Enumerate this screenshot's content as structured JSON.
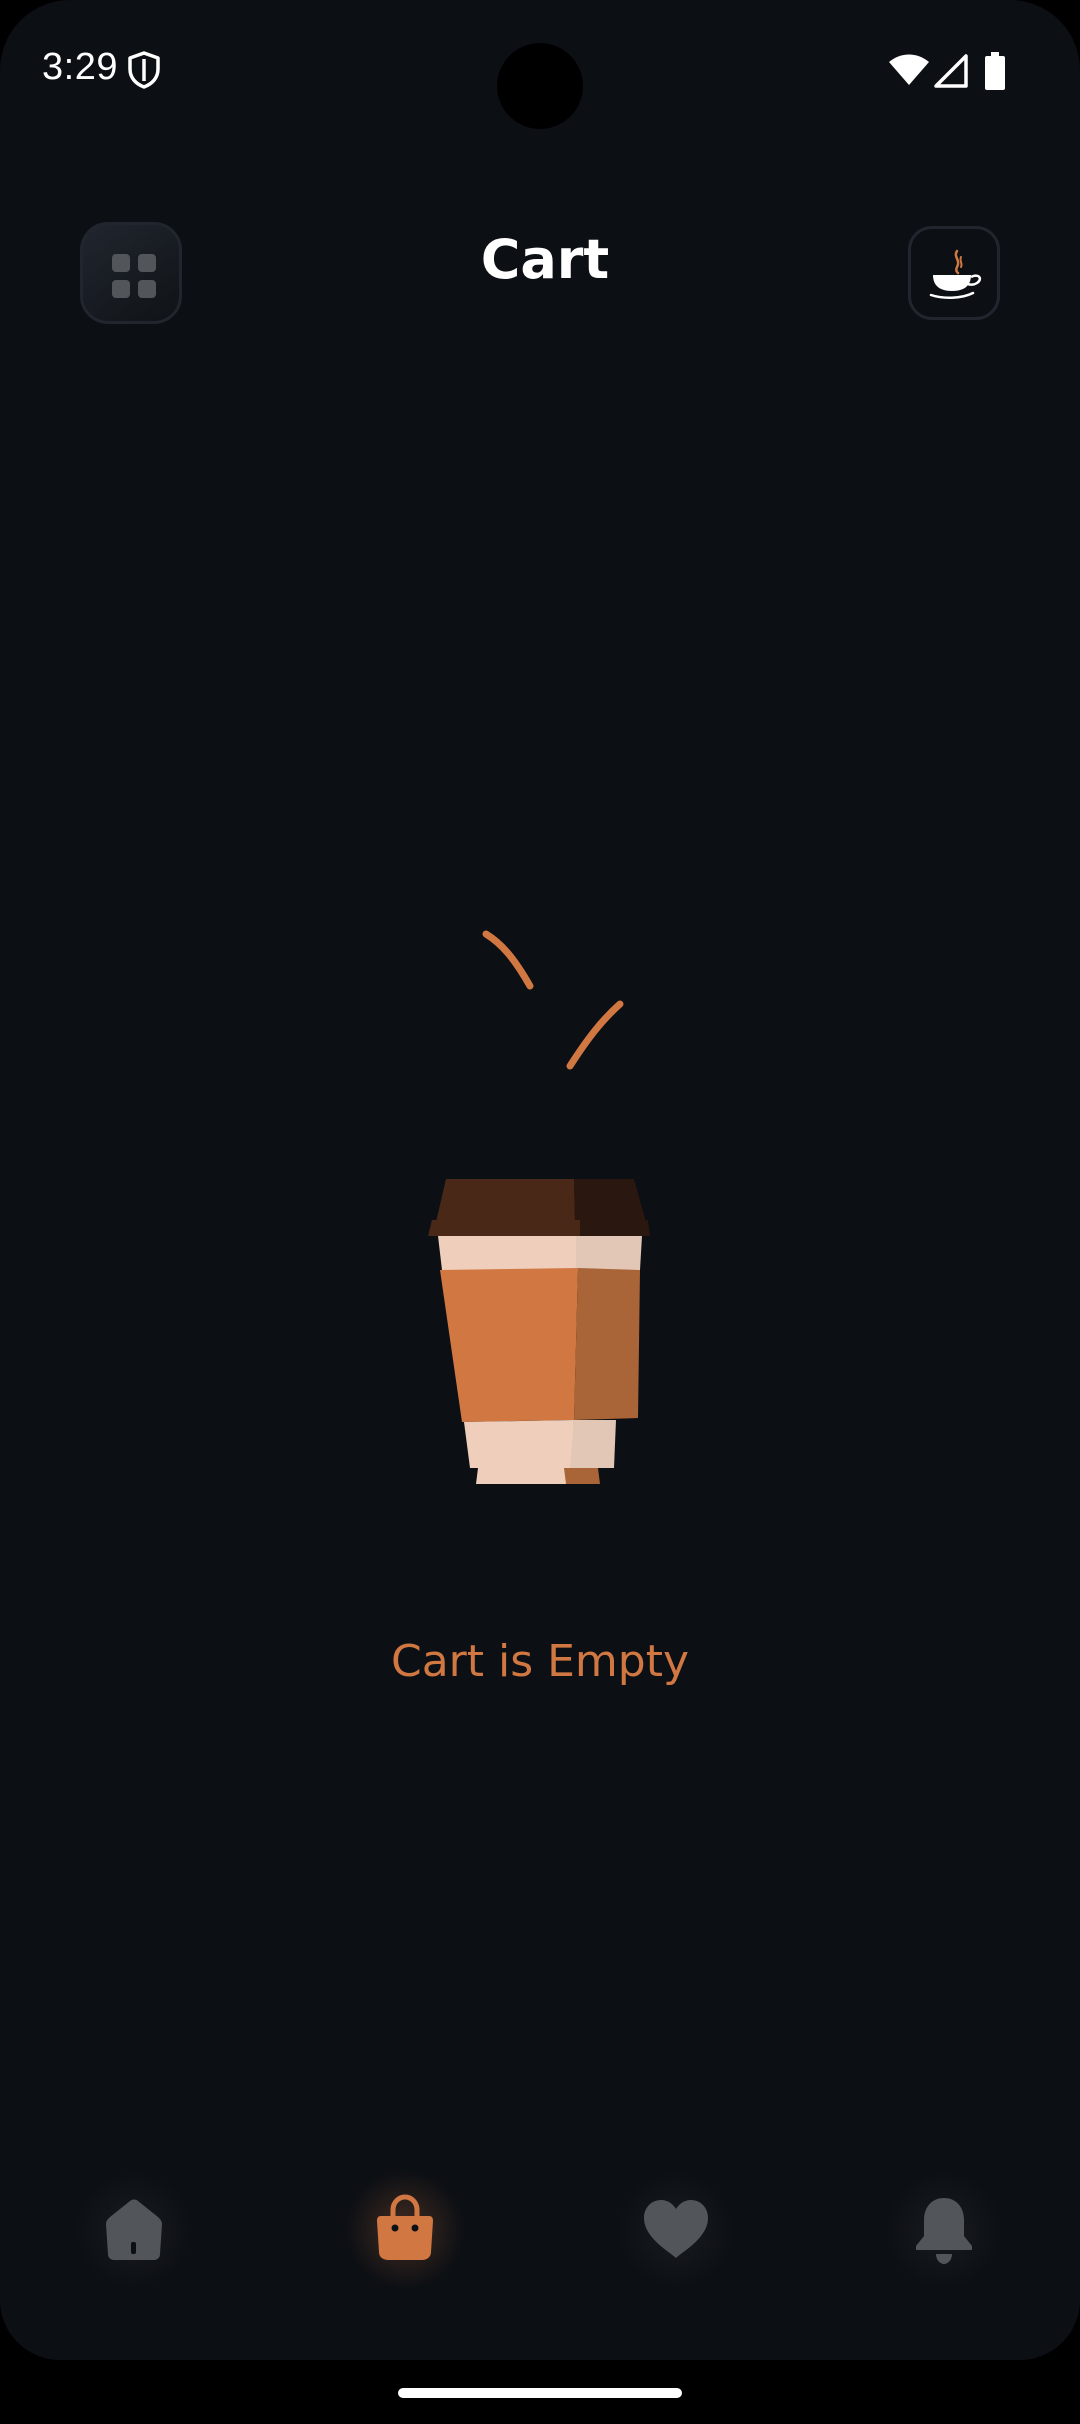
{
  "status_bar": {
    "time": "3:29",
    "icons": [
      "shield-icon",
      "wifi-icon",
      "signal-icon",
      "battery-icon"
    ]
  },
  "header": {
    "title": "Cart",
    "menu_icon": "grid-menu-icon",
    "profile_icon": "coffee-cup-logo-icon"
  },
  "empty_state": {
    "illustration": "coffee-cup-illustration",
    "message": "Cart is Empty"
  },
  "bottom_nav": {
    "items": [
      {
        "icon": "home-icon",
        "active": false
      },
      {
        "icon": "shopping-bag-icon",
        "active": true
      },
      {
        "icon": "heart-icon",
        "active": false
      },
      {
        "icon": "bell-icon",
        "active": false
      }
    ]
  },
  "colors": {
    "background": "#0c0f14",
    "accent": "#d17842",
    "inactive_icon": "#52555a",
    "text_primary": "#ffffff"
  }
}
